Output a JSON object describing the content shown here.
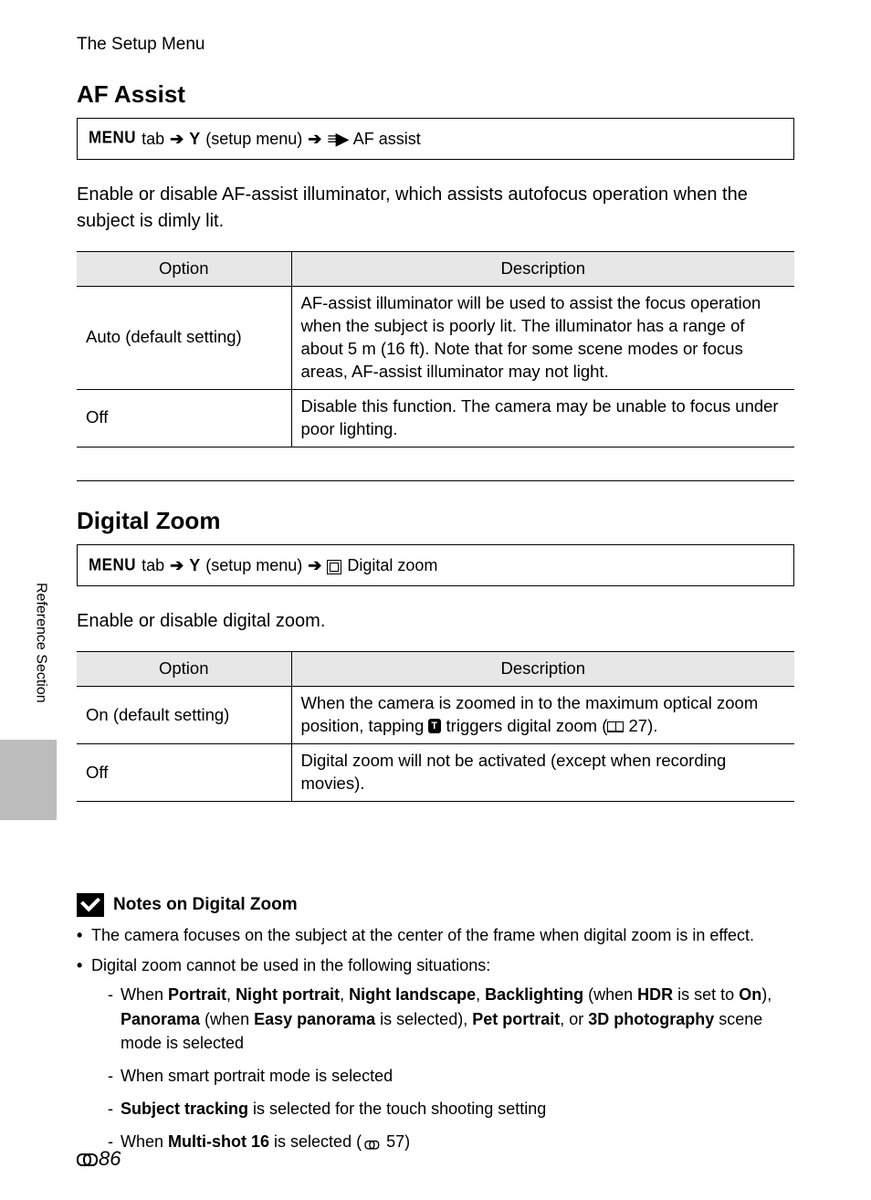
{
  "running_head": "The Setup Menu",
  "section1": {
    "title": "AF Assist",
    "nav": {
      "menu": "MENU",
      "tab": "tab",
      "step1": "(setup menu)",
      "step2": "AF assist"
    },
    "intro": "Enable or disable AF-assist illuminator, which assists autofocus operation when the subject is dimly lit.",
    "headers": {
      "col1": "Option",
      "col2": "Description"
    },
    "rows": [
      {
        "option": "Auto (default setting)",
        "desc": "AF-assist illuminator will be used to assist the focus operation when the subject is poorly lit. The illuminator has a range of about 5 m (16 ft). Note that for some scene modes or focus areas, AF-assist illuminator may not light."
      },
      {
        "option": "Off",
        "desc": "Disable this function. The camera may be unable to focus under poor lighting."
      }
    ]
  },
  "section2": {
    "title": "Digital Zoom",
    "nav": {
      "menu": "MENU",
      "tab": "tab",
      "step1": "(setup menu)",
      "step2": "Digital zoom"
    },
    "intro": "Enable or disable digital zoom.",
    "headers": {
      "col1": "Option",
      "col2": "Description"
    },
    "rows": [
      {
        "option": "On (default setting)",
        "desc_a": "When the camera is zoomed in to the maximum optical zoom position, tapping ",
        "desc_b": " triggers digital zoom (",
        "desc_c": " 27)."
      },
      {
        "option": "Off",
        "desc": "Digital zoom will not be activated (except when recording movies)."
      }
    ]
  },
  "side_tab": "Reference Section",
  "notes": {
    "title": "Notes on Digital Zoom",
    "items": {
      "i1": "The camera focuses on the subject at the center of the frame when digital zoom is in effect.",
      "i2": "Digital zoom cannot be used in the following situations:",
      "sub": {
        "s1a": "When ",
        "s1b": "Portrait",
        "s1c": ", ",
        "s1d": "Night portrait",
        "s1e": ", ",
        "s1f": "Night landscape",
        "s1g": ", ",
        "s1h": "Backlighting",
        "s1i": " (when ",
        "s1j": "HDR",
        "s1k": " is set to ",
        "s1l": "On",
        "s1m": "), ",
        "s1n": "Panorama",
        "s1o": " (when ",
        "s1p": "Easy panorama",
        "s1q": " is selected), ",
        "s1r": "Pet portrait",
        "s1s": ", or ",
        "s1t": "3D photography",
        "s1u": " scene mode is selected",
        "s2": "When smart portrait mode is selected",
        "s3a": "Subject tracking",
        "s3b": " is selected for the touch shooting setting",
        "s4a": "When ",
        "s4b": "Multi-shot 16",
        "s4c": " is selected (",
        "s4d": " 57)"
      }
    }
  },
  "page_number": "86"
}
